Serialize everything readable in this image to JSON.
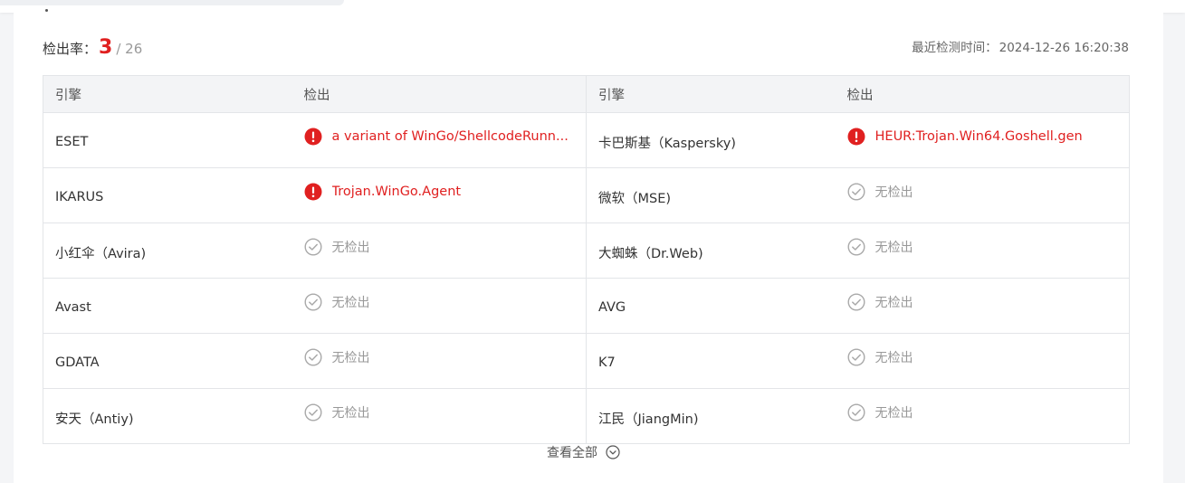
{
  "summary": {
    "rate_label": "检出率：",
    "detected": "3",
    "total": "/ 26",
    "last_check_label": "最近检测时间：",
    "last_check_time": "2024-12-26 16:20:38"
  },
  "table": {
    "headers": [
      "引擎",
      "检出",
      "引擎",
      "检出"
    ],
    "rows": [
      {
        "left_engine": "ESET",
        "left_result": "a variant of WinGo/ShellcodeRunn...",
        "left_status": "detected",
        "right_engine": "卡巴斯基（Kaspersky)",
        "right_result": "HEUR:Trojan.Win64.Goshell.gen",
        "right_status": "detected"
      },
      {
        "left_engine": "IKARUS",
        "left_result": "Trojan.WinGo.Agent",
        "left_status": "detected",
        "right_engine": "微软（MSE)",
        "right_result": "无检出",
        "right_status": "clean"
      },
      {
        "left_engine": "小红伞（Avira)",
        "left_result": "无检出",
        "left_status": "clean",
        "right_engine": "大蜘蛛（Dr.Web)",
        "right_result": "无检出",
        "right_status": "clean"
      },
      {
        "left_engine": "Avast",
        "left_result": "无检出",
        "left_status": "clean",
        "right_engine": "AVG",
        "right_result": "无检出",
        "right_status": "clean"
      },
      {
        "left_engine": "GDATA",
        "left_result": "无检出",
        "left_status": "clean",
        "right_engine": "K7",
        "right_result": "无检出",
        "right_status": "clean"
      },
      {
        "left_engine": "安天（Antiy)",
        "left_result": "无检出",
        "left_status": "clean",
        "right_engine": "江民（JiangMin)",
        "right_result": "无检出",
        "right_status": "clean"
      }
    ]
  },
  "icons": {
    "detected": "alert-circle-icon",
    "clean": "check-circle-icon",
    "expand": "chevron-down-circle-icon"
  },
  "colors": {
    "detected": "#e02020",
    "clean": "#999999"
  },
  "footer": {
    "view_all_label": "查看全部"
  }
}
